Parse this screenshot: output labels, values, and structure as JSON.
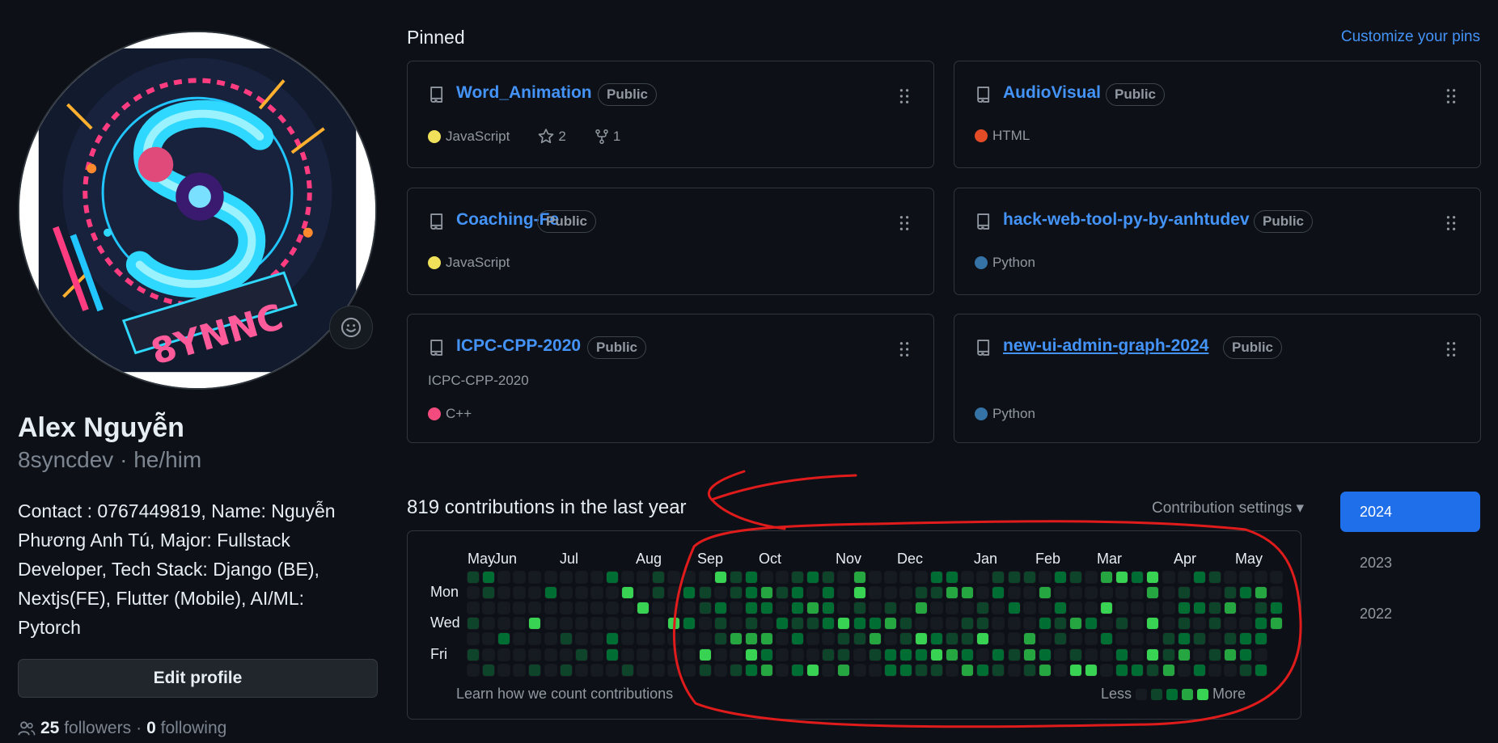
{
  "profile": {
    "name": "Alex Nguyễn",
    "login": "8syncdev",
    "separator": " · ",
    "pronouns": "he/him",
    "bio": "Contact : 0767449819, Name: Nguyễn Phương Anh Tú, Major: Fullstack Developer, Tech Stack: Django (BE), Nextjs(FE), Flutter (Mobile), AI/ML: Pytorch",
    "edit_label": "Edit profile",
    "followers_count": "25",
    "followers_label": "followers",
    "following_count": "0",
    "following_label": "following",
    "dot": "·",
    "avatar_text": "8YNNC",
    "status_icon": "smiley-icon"
  },
  "pinned": {
    "title": "Pinned",
    "customize_label": "Customize your pins",
    "repos": [
      {
        "name": "Word_Animation",
        "visibility": "Public",
        "language": "JavaScript",
        "lang_color": "#f1e05a",
        "stars": "2",
        "forks": "1",
        "description": ""
      },
      {
        "name": "AudioVisual",
        "visibility": "Public",
        "language": "HTML",
        "lang_color": "#e34c26",
        "description": ""
      },
      {
        "name": "Coaching-Fe",
        "visibility": "Public",
        "language": "JavaScript",
        "lang_color": "#f1e05a",
        "description": ""
      },
      {
        "name": "hack-web-tool-py-by-anhtudev",
        "visibility": "Public",
        "language": "Python",
        "lang_color": "#3572A5",
        "description": ""
      },
      {
        "name": "ICPC-CPP-2020",
        "visibility": "Public",
        "language": "C++",
        "lang_color": "#f34b7d",
        "description": "ICPC-CPP-2020"
      },
      {
        "name": "new-ui-admin-graph-2024 ",
        "visibility": "Public",
        "language": "Python",
        "lang_color": "#3572A5",
        "description": ""
      }
    ]
  },
  "contributions": {
    "title": "819 contributions in the last year",
    "settings_label": "Contribution settings ▾",
    "months": [
      "May",
      "Jun",
      "Jul",
      "Aug",
      "Sep",
      "Oct",
      "Nov",
      "Dec",
      "Jan",
      "Feb",
      "Mar",
      "Apr",
      "May"
    ],
    "days": [
      "Mon",
      "Wed",
      "Fri"
    ],
    "learn_label": "Learn how we count contributions",
    "legend_less": "Less",
    "legend_more": "More",
    "level_colors": [
      "#161b22",
      "#0e4429",
      "#006d32",
      "#26a641",
      "#39d353"
    ]
  },
  "years": {
    "items": [
      "2024",
      "2023",
      "2022"
    ],
    "selected": "2024"
  },
  "colors": {
    "accent": "#4493f8",
    "year_active": "#1f6feb",
    "annotation": "#e01b1b"
  }
}
